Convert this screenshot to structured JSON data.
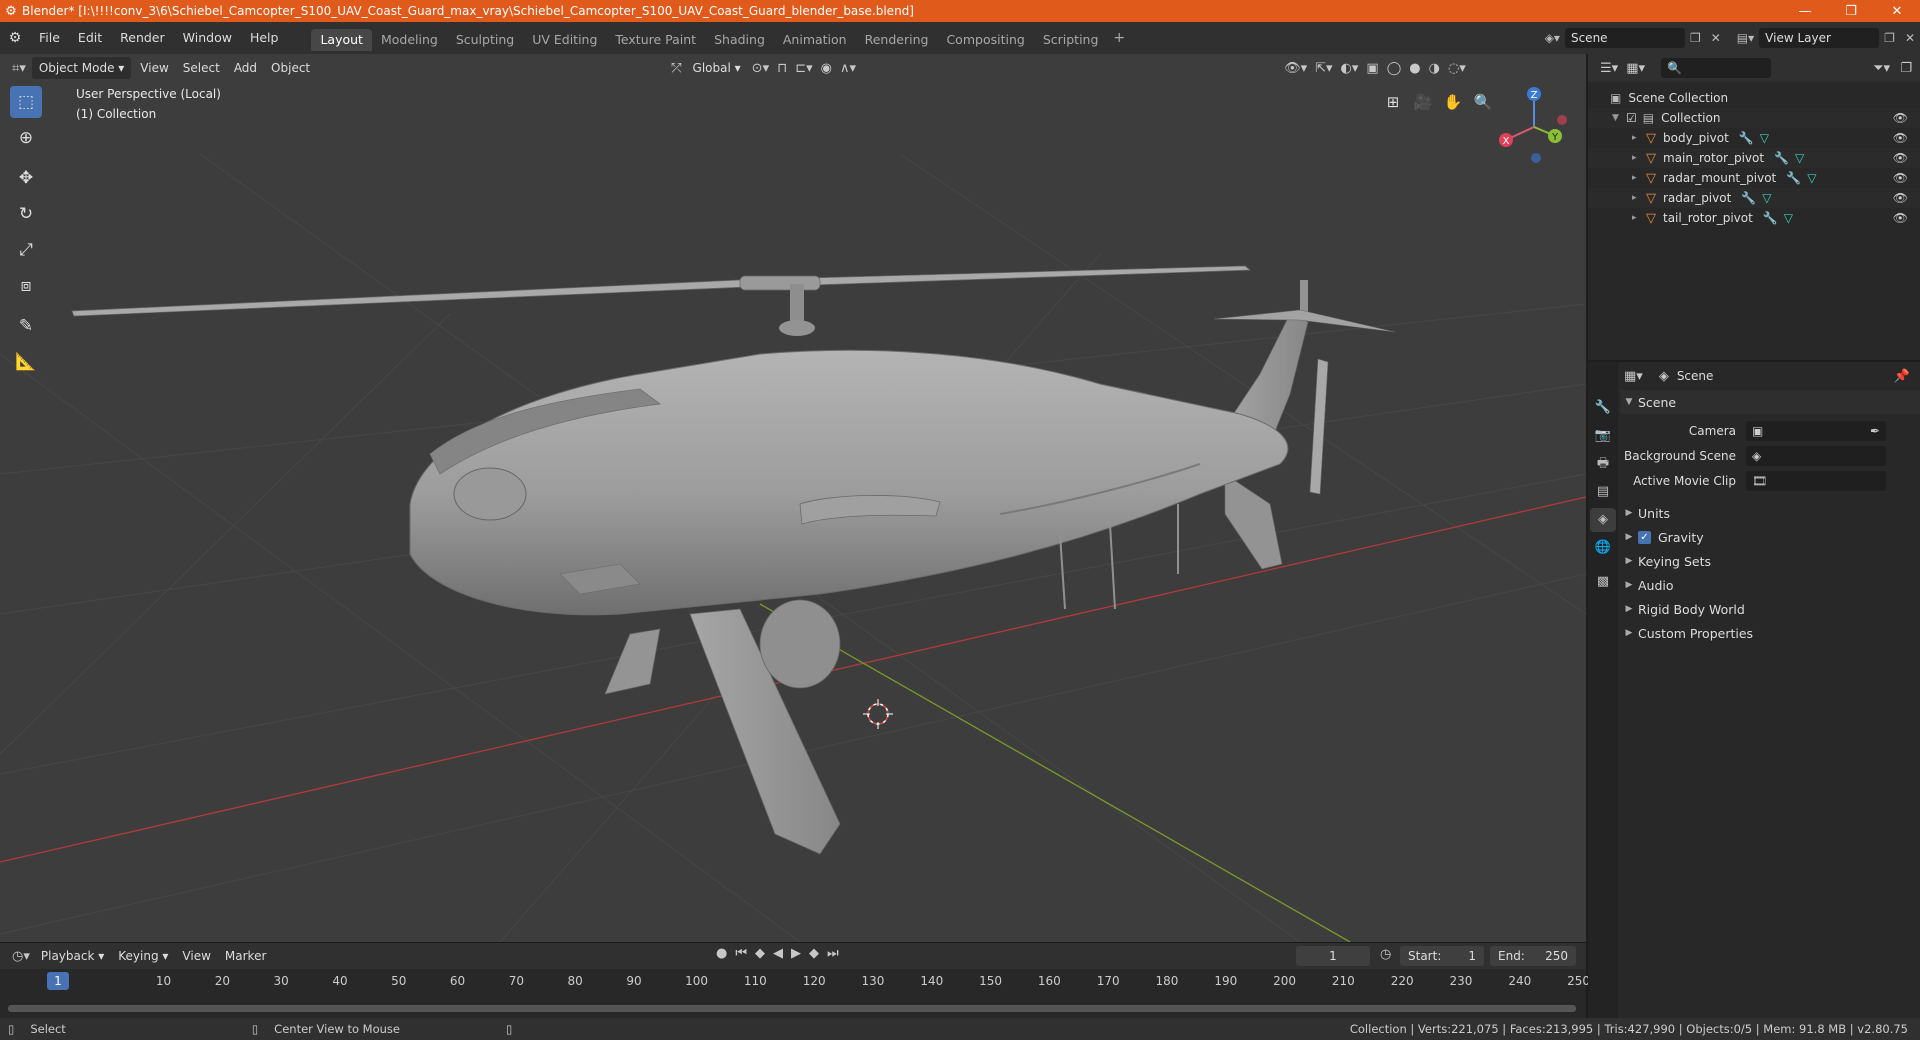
{
  "titlebar": {
    "text": "Blender* [I:\\!!!!conv_3\\6\\Schiebel_Camcopter_S100_UAV_Coast_Guard_max_vray\\Schiebel_Camcopter_S100_UAV_Coast_Guard_blender_base.blend]",
    "minimize": "—",
    "maximize": "❐",
    "close": "✕"
  },
  "menubar": {
    "items": [
      "File",
      "Edit",
      "Render",
      "Window",
      "Help"
    ],
    "workspaces": [
      "Layout",
      "Modeling",
      "Sculpting",
      "UV Editing",
      "Texture Paint",
      "Shading",
      "Animation",
      "Rendering",
      "Compositing",
      "Scripting"
    ],
    "add": "+",
    "scene_label": "Scene",
    "view_layer_label": "View Layer"
  },
  "viewport": {
    "mode": "Object Mode",
    "menus": [
      "View",
      "Select",
      "Add",
      "Object"
    ],
    "transform": "Global",
    "info_line1": "User Perspective (Local)",
    "info_line2": "(1) Collection",
    "gizmo": {
      "x": "X",
      "y": "Y",
      "z": "Z"
    },
    "colors": {
      "x_axis": "#b03a3a",
      "y_axis": "#7a9a2a",
      "bg": "#3d3d3d"
    }
  },
  "timeline": {
    "menus": [
      "Playback",
      "Keying",
      "View",
      "Marker"
    ],
    "current_frame": "1",
    "start_label": "Start:",
    "start_value": "1",
    "end_label": "End:",
    "end_value": "250",
    "ticks": [
      "10",
      "20",
      "30",
      "40",
      "50",
      "60",
      "70",
      "80",
      "90",
      "100",
      "110",
      "120",
      "130",
      "140",
      "150",
      "160",
      "170",
      "180",
      "190",
      "200",
      "210",
      "220",
      "230",
      "240",
      "250"
    ],
    "cursor_frame": "1"
  },
  "statusbar": {
    "select": "Select",
    "center_view": "Center View to Mouse",
    "stats": "Collection | Verts:221,075 | Faces:213,995 | Tris:427,990 | Objects:0/5 | Mem: 91.8 MB | v2.80.75"
  },
  "outliner": {
    "scene_collection": "Scene Collection",
    "collection": "Collection",
    "objects": [
      "body_pivot",
      "main_rotor_pivot",
      "radar_mount_pivot",
      "radar_pivot",
      "tail_rotor_pivot"
    ]
  },
  "properties": {
    "header": "Scene",
    "section": "Scene",
    "camera_label": "Camera",
    "background_scene_label": "Background Scene",
    "active_movie_clip_label": "Active Movie Clip",
    "subsections": [
      "Units",
      "Gravity",
      "Keying Sets",
      "Audio",
      "Rigid Body World",
      "Custom Properties"
    ]
  }
}
